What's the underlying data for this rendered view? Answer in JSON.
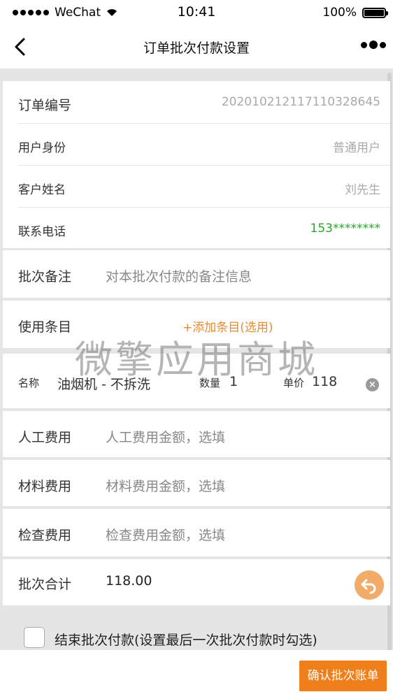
{
  "status_bar": {
    "carrier": "WeChat",
    "time": "10:41",
    "battery": "100%"
  },
  "nav": {
    "title": "订单批次付款设置"
  },
  "order": {
    "id_label": "订单编号",
    "id_value": "20201021211711032864​5",
    "identity_label": "用户身份",
    "identity_value": "普通用户",
    "customer_label": "客户姓名",
    "customer_value": "刘先生",
    "phone_label": "联系电话",
    "phone_value": "153********"
  },
  "batch_note": {
    "label": "批次备注",
    "placeholder": "对本批次付款的备注信息"
  },
  "items": {
    "label": "使用条目",
    "add_label": "+添加条目(选用)"
  },
  "item": {
    "name_label": "名称",
    "name": "油烟机 - 不拆洗",
    "qty_label": "数量",
    "qty": "1",
    "price_label": "单价",
    "price": "118",
    "delete_icon": "×"
  },
  "labor": {
    "label": "人工费用",
    "placeholder": "人工费用金额，选填"
  },
  "material": {
    "label": "材料费用",
    "placeholder": "材料费用金额，选填"
  },
  "inspection": {
    "label": "检查费用",
    "placeholder": "检查费用金额，选填"
  },
  "total": {
    "label": "批次合计",
    "value": "118.00"
  },
  "watermark": "微擎应用商城",
  "end_batch": {
    "label": "结束批次付款(设置最后一次批次付款时勾选)"
  },
  "confirm": {
    "label": "确认批次账单"
  },
  "colors": {
    "accent": "#ef7f1a",
    "green": "#2aa52a",
    "fab": "#f3ab69"
  }
}
